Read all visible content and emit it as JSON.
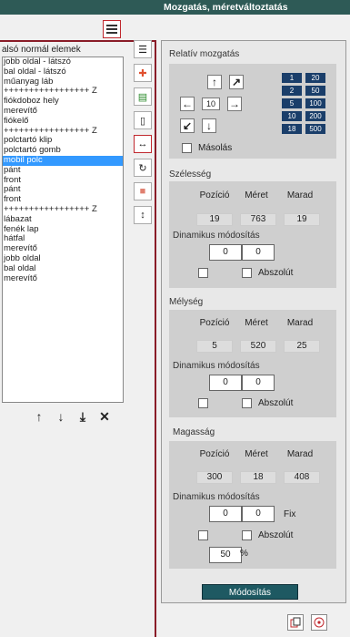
{
  "window": {
    "title": "Mozgatás, méretváltoztatás"
  },
  "list": {
    "header": "alsó normál elemek",
    "items": [
      "jobb oldal - látszó",
      "bal oldal - látszó",
      "műanyag láb",
      "+++++++++++++++++ Z",
      "fiókdoboz hely",
      "merevítő",
      "fiókelő",
      "+++++++++++++++++ Z",
      "polctartó klip",
      "polctartó gomb",
      "mobil polc",
      "pánt",
      "front",
      "pánt",
      "front",
      "+++++++++++++++++ Z",
      "lábazat",
      "fenék lap",
      "hátfal",
      "merevítő",
      "jobb oldal",
      "bal oldal",
      "merevítő"
    ],
    "selected_index": 10
  },
  "move": {
    "label": "Relatív mozgatás",
    "step_value": "10",
    "copy_label": "Másolás",
    "steps": [
      "1",
      "20",
      "2",
      "50",
      "5",
      "100",
      "10",
      "200",
      "18",
      "500"
    ]
  },
  "width": {
    "label": "Szélesség",
    "headers": [
      "Pozíció",
      "Méret",
      "Marad"
    ],
    "values": [
      "19",
      "763",
      "19"
    ],
    "dyn_label": "Dinamikus módosítás",
    "dyn_values": [
      "0",
      "0"
    ],
    "abs_label": "Abszolút"
  },
  "depth": {
    "label": "Mélység",
    "headers": [
      "Pozíció",
      "Méret",
      "Marad"
    ],
    "values": [
      "5",
      "520",
      "25"
    ],
    "dyn_label": "Dinamikus módosítás",
    "dyn_values": [
      "0",
      "0"
    ],
    "abs_label": "Abszolút"
  },
  "height": {
    "label": "Magasság",
    "headers": [
      "Pozíció",
      "Méret",
      "Marad"
    ],
    "values": [
      "300",
      "18",
      "408"
    ],
    "dyn_label": "Dinamikus módosítás",
    "dyn_values": [
      "0",
      "0"
    ],
    "fix_label": "Fix",
    "abs_label": "Abszolút",
    "percent_value": "50",
    "percent_sign": "%"
  },
  "modify_label": "Módosítás"
}
